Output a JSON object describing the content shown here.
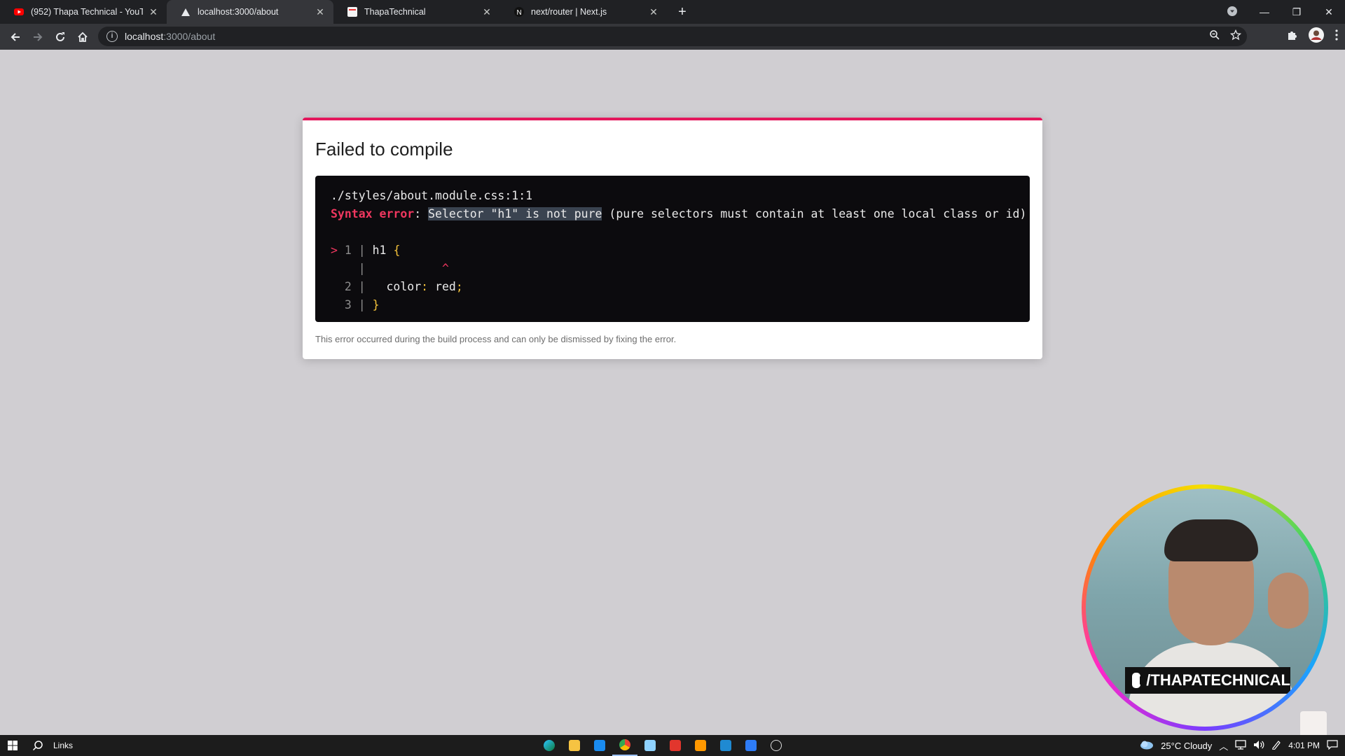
{
  "browser": {
    "tabs": [
      {
        "title": "(952) Thapa Technical - YouTube",
        "favicon": "youtube-icon",
        "active": false
      },
      {
        "title": "localhost:3000/about",
        "favicon": "nextjs-triangle-icon",
        "active": true
      },
      {
        "title": "ThapaTechnical",
        "favicon": "page-icon",
        "active": false
      },
      {
        "title": "next/router | Next.js",
        "favicon": "nextjs-n-icon",
        "active": false
      }
    ],
    "new_tab_label": "+",
    "url_host": "localhost",
    "url_path": ":3000/about"
  },
  "overlay": {
    "title": "Failed to compile",
    "file": "./styles/about.module.css:1:1",
    "error_label": "Syntax error",
    "error_sep": ": ",
    "error_selected": "Selector \"h1\" is not pure",
    "error_rest": " (pure selectors must contain at least one local class or id)",
    "code": {
      "l1_marker": ">",
      "l1_num": "1",
      "l1_text": "h1 ",
      "l1_brace": "{",
      "caret": "^",
      "l2_num": "2",
      "l2_prop": "color",
      "l2_colon": ":",
      "l2_val": " red",
      "l2_semi": ";",
      "l3_num": "3",
      "l3_brace": "}"
    },
    "footer": "This error occurred during the build process and can only be dismissed by fixing the error."
  },
  "webcam": {
    "banner": "/THAPATECHNICAL"
  },
  "taskbar": {
    "search_label": "Links",
    "weather": "25°C  Cloudy",
    "time": "4:01 PM"
  },
  "colors": {
    "accent": "#e3175c",
    "error": "#f0375f",
    "brace": "#f5c33b"
  }
}
